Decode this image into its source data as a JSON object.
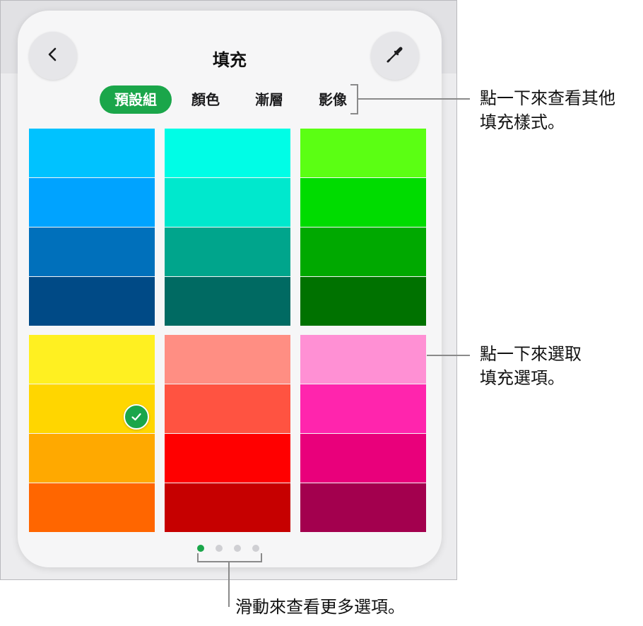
{
  "popover": {
    "title": "填充",
    "back_icon": "chevron-left-icon",
    "picker_icon": "eyedropper-icon"
  },
  "tabs": [
    {
      "label": "預設組",
      "active": true
    },
    {
      "label": "顏色",
      "active": false
    },
    {
      "label": "漸層",
      "active": false
    },
    {
      "label": "影像",
      "active": false
    }
  ],
  "swatches": {
    "groups": [
      {
        "colors": [
          "#00c2ff",
          "#00a3ff",
          "#0070bb",
          "#004a86"
        ]
      },
      {
        "colors": [
          "#00fde6",
          "#00e8cd",
          "#00a58c",
          "#006a62"
        ]
      },
      {
        "colors": [
          "#5bff13",
          "#00dc00",
          "#00a900",
          "#007200"
        ]
      },
      {
        "colors": [
          "#fff021",
          "#ffd600",
          "#ffa900",
          "#ff6600"
        ],
        "selected_index": 1
      },
      {
        "colors": [
          "#ff8e83",
          "#ff5341",
          "#ff0000",
          "#c60000"
        ]
      },
      {
        "colors": [
          "#ff90d4",
          "#ff25ad",
          "#e9007b",
          "#a3004e"
        ]
      }
    ],
    "selected_icon": "checkmark-icon"
  },
  "pager": {
    "page_count": 4,
    "current_page": 1
  },
  "callouts": {
    "tabs_text": [
      "點一下來查看其他",
      "填充樣式。"
    ],
    "swatch_text": [
      "點一下來選取",
      "填充選項。"
    ],
    "pager_text": "滑動來查看更多選項。"
  },
  "colors": {
    "accent": "#1aa64a",
    "callout_line": "#8a8a8a"
  }
}
